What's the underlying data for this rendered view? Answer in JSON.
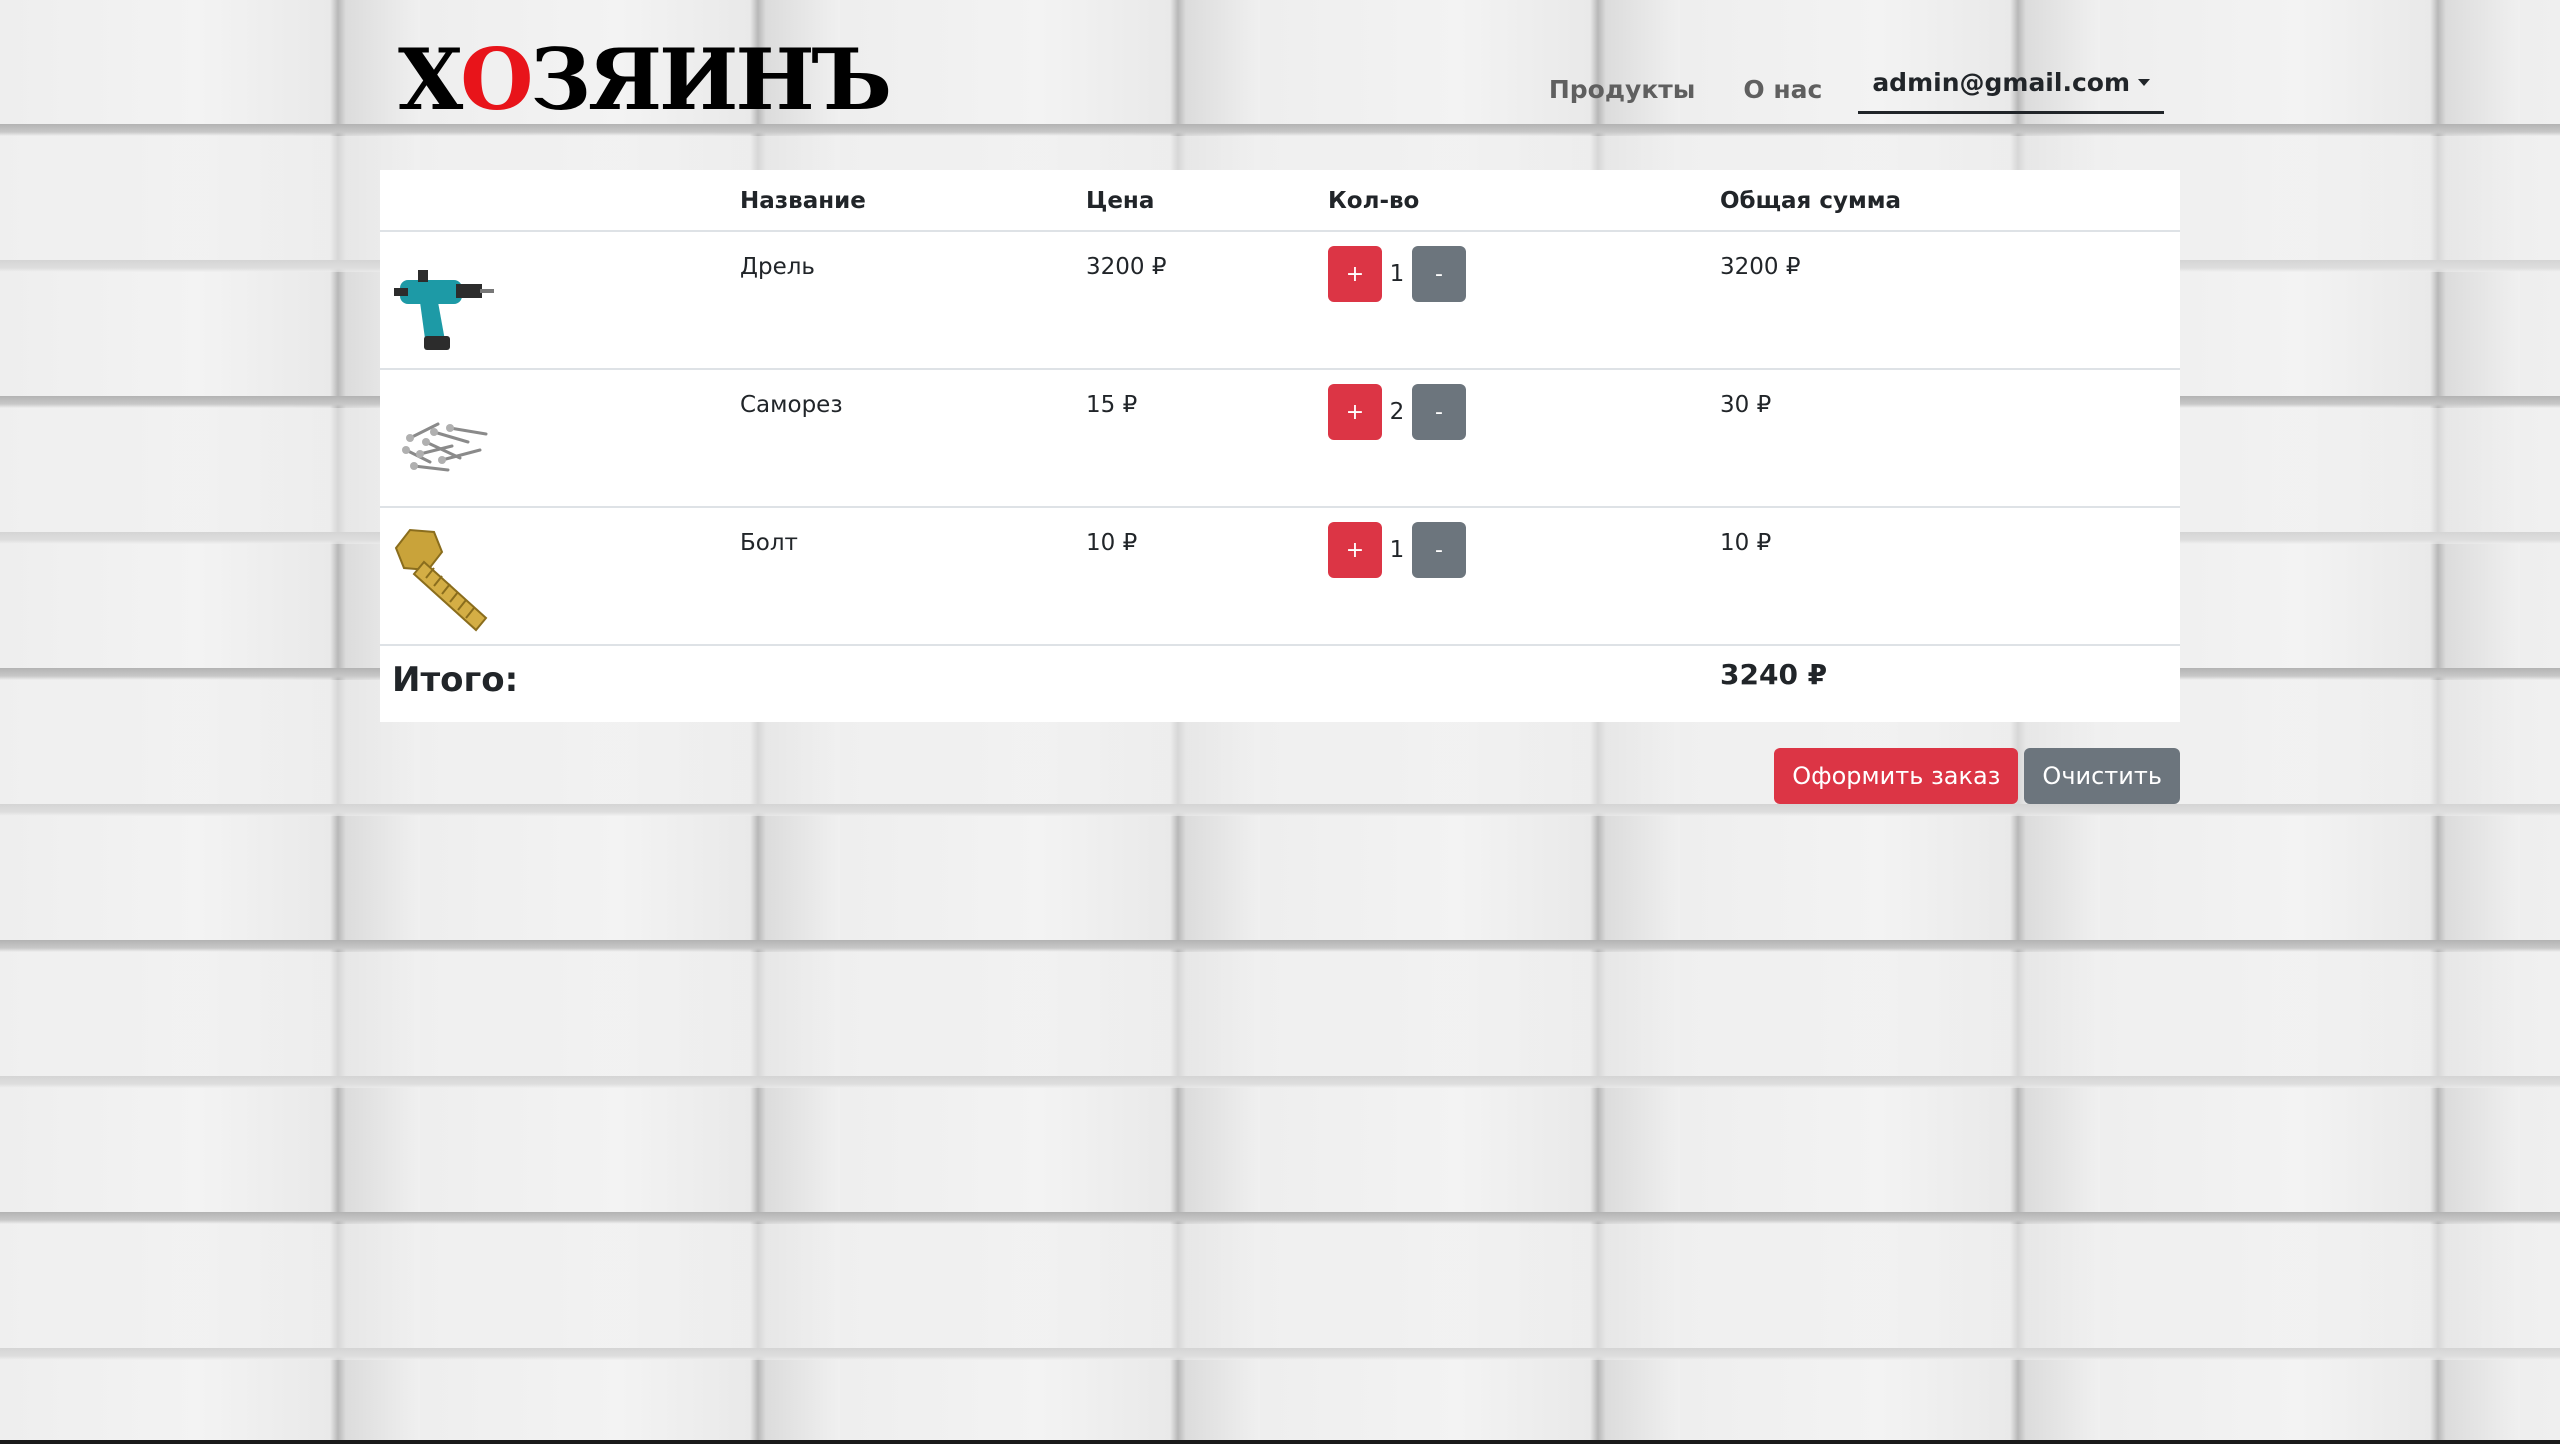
{
  "brand": {
    "logo_part1": "Х",
    "logo_part2": "О",
    "logo_part3": "ЗЯИНЪ"
  },
  "nav": {
    "products": "Продукты",
    "about": "О нас",
    "user": "admin@gmail.com"
  },
  "table": {
    "headers": {
      "name": "Название",
      "price": "Цена",
      "qty": "Кол-во",
      "sum": "Общая сумма"
    },
    "items": [
      {
        "name": "Дрель",
        "price": "3200 ₽",
        "qty": "1",
        "sum": "3200 ₽",
        "image": "drill-image"
      },
      {
        "name": "Саморез",
        "price": "15 ₽",
        "qty": "2",
        "sum": "30 ₽",
        "image": "screws-image"
      },
      {
        "name": "Болт",
        "price": "10 ₽",
        "qty": "1",
        "sum": "10 ₽",
        "image": "bolt-image"
      }
    ],
    "plus_label": "+",
    "minus_label": "-",
    "total_label": "Итого:",
    "total_sum": "3240 ₽"
  },
  "actions": {
    "order": "Оформить заказ",
    "clear": "Очистить"
  },
  "colors": {
    "danger": "#dc3545",
    "secondary": "#6c757d",
    "logo_accent": "#e8141a"
  }
}
